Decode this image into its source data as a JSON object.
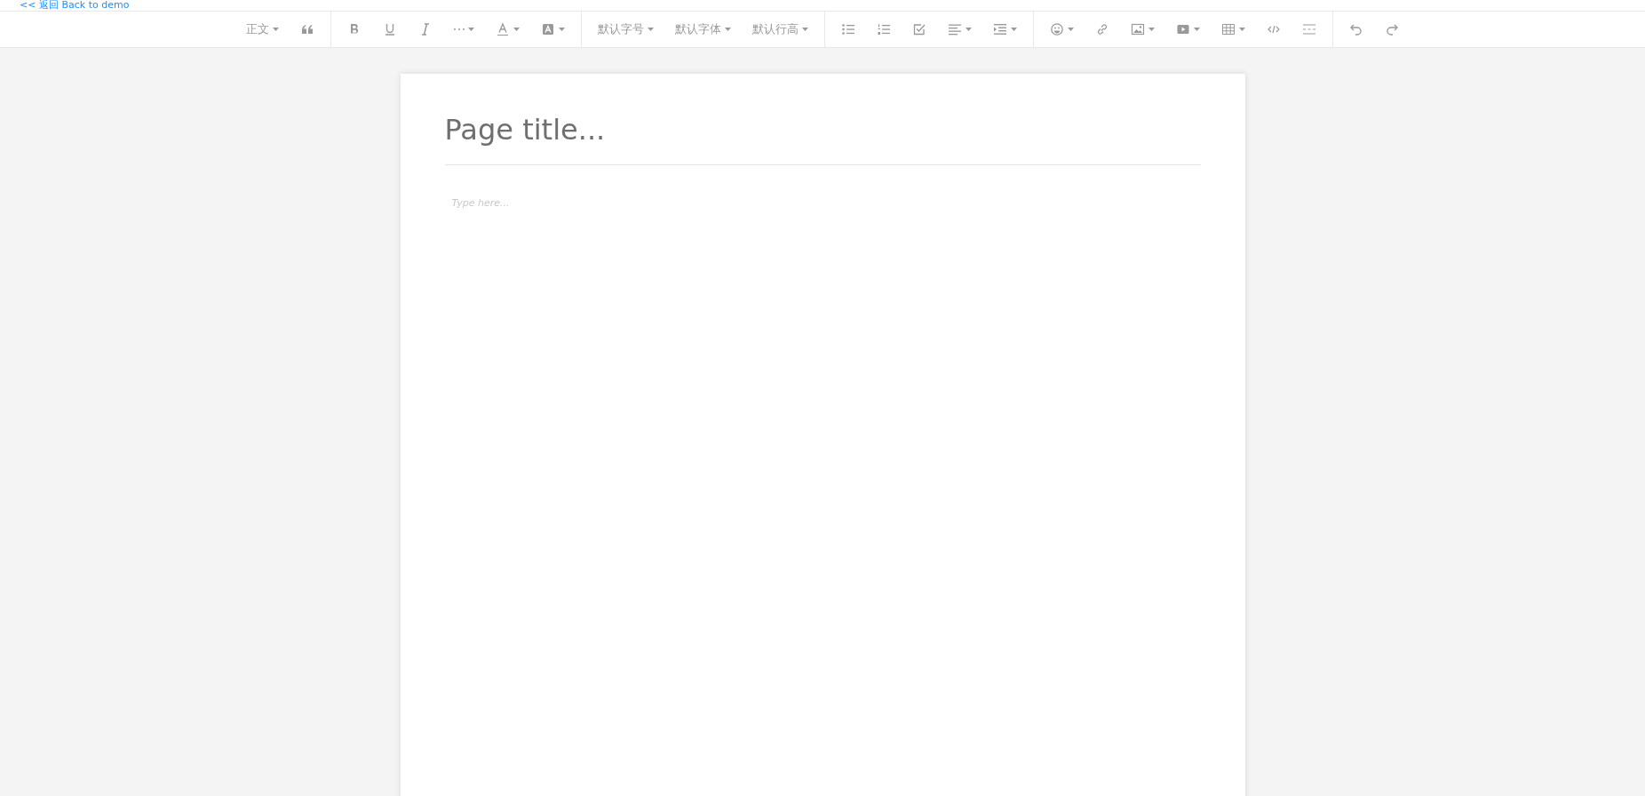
{
  "back_link": "<< 返回 Back to demo",
  "toolbar": {
    "groups": [
      {
        "items": [
          {
            "kind": "label",
            "label": "正文",
            "dropdown": true
          },
          {
            "kind": "quote",
            "dropdown": false
          }
        ]
      },
      {
        "items": [
          {
            "kind": "bold",
            "dropdown": false
          },
          {
            "kind": "underline",
            "dropdown": false
          },
          {
            "kind": "italic",
            "dropdown": false
          },
          {
            "kind": "more",
            "dropdown": true
          },
          {
            "kind": "font-color",
            "dropdown": true
          },
          {
            "kind": "background-color",
            "dropdown": true
          }
        ]
      },
      {
        "items": [
          {
            "kind": "label",
            "label": "默认字号",
            "dropdown": true
          },
          {
            "kind": "label",
            "label": "默认字体",
            "dropdown": true
          },
          {
            "kind": "label",
            "label": "默认行高",
            "dropdown": true
          }
        ]
      },
      {
        "items": [
          {
            "kind": "bullet-list",
            "dropdown": false
          },
          {
            "kind": "numbered-list",
            "dropdown": false
          },
          {
            "kind": "todo",
            "dropdown": false
          },
          {
            "kind": "align",
            "dropdown": true
          },
          {
            "kind": "indent",
            "dropdown": true
          }
        ]
      },
      {
        "items": [
          {
            "kind": "emoji",
            "dropdown": true
          },
          {
            "kind": "link",
            "dropdown": false
          },
          {
            "kind": "image",
            "dropdown": true
          },
          {
            "kind": "video",
            "dropdown": true
          },
          {
            "kind": "table",
            "dropdown": true
          },
          {
            "kind": "code",
            "dropdown": false
          },
          {
            "kind": "divider",
            "dropdown": false
          }
        ]
      },
      {
        "items": [
          {
            "kind": "undo",
            "dropdown": false
          },
          {
            "kind": "redo",
            "dropdown": false
          }
        ]
      }
    ]
  },
  "editor": {
    "title_placeholder": "Page title...",
    "body_placeholder": "Type here..."
  }
}
